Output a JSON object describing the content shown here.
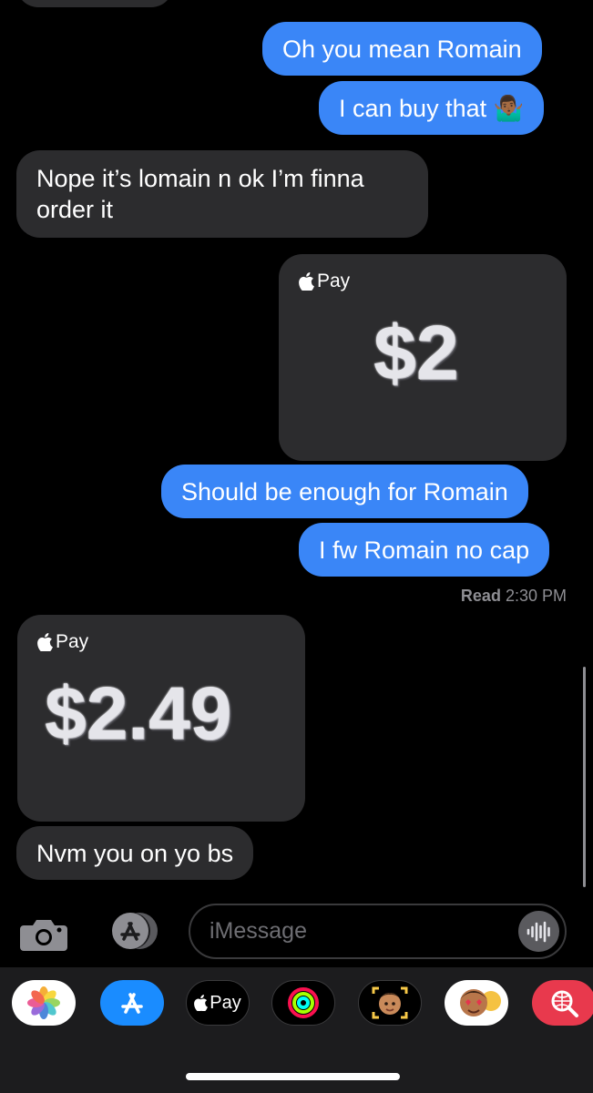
{
  "messages": [
    {
      "text": "Oh you mean Romain"
    },
    {
      "text": "I can buy that 🤷🏾‍♂️"
    },
    {
      "text": "Nope it’s lomain n ok I’m finna order it"
    },
    {
      "pay_label": "Pay",
      "amount": "$2"
    },
    {
      "text": "Should be enough for Romain"
    },
    {
      "text": "I fw Romain no cap"
    },
    {
      "pay_label": "Pay",
      "amount": "$2.49"
    },
    {
      "text": "Nvm you on yo bs"
    }
  ],
  "read_receipt": {
    "label": "Read",
    "time": "2:30 PM"
  },
  "composer": {
    "placeholder": "iMessage"
  },
  "app_tray": {
    "apps": [
      "photos-icon",
      "app-store-icon",
      "apple-pay-icon",
      "activity-icon",
      "memoji-camera-icon",
      "memoji-stickers-icon",
      "search-images-icon"
    ],
    "apple_pay_label": "Pay"
  },
  "colors": {
    "outgoing": "#3a86f7",
    "incoming": "#2c2c2e",
    "background": "#000000"
  }
}
